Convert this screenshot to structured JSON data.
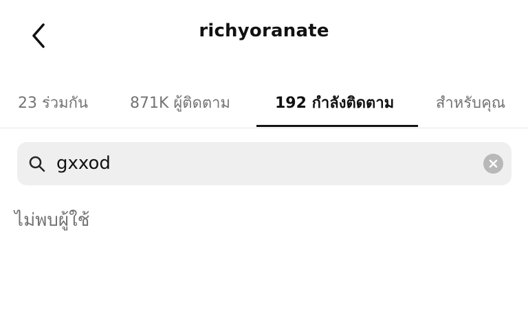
{
  "header": {
    "title": "richyoranate"
  },
  "tabs": [
    {
      "label": "23 ร่วมกัน",
      "active": false
    },
    {
      "label": "871K ผู้ติดตาม",
      "active": false
    },
    {
      "label": "192 กำลังติดตาม",
      "active": true
    },
    {
      "label": "สำหรับคุณ",
      "active": false
    }
  ],
  "search": {
    "value": "gxxod",
    "icon": "search-icon",
    "clear_icon": "clear-icon"
  },
  "results": {
    "empty_message": "ไม่พบผู้ใช้"
  },
  "colors": {
    "accent": "#111111",
    "muted": "#737373",
    "search_bg": "#efefef"
  }
}
